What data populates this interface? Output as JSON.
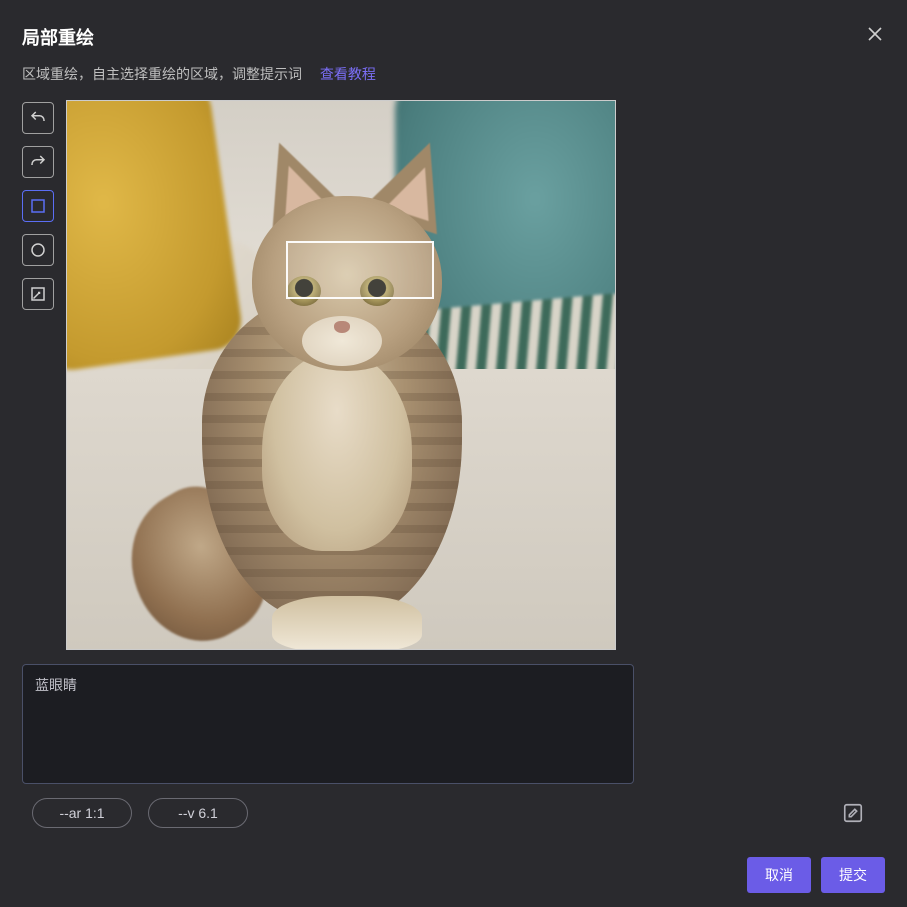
{
  "modal": {
    "title": "局部重绘",
    "subtitle": "区域重绘，自主选择重绘的区域，调整提示词",
    "tutorial_link": "查看教程"
  },
  "tools": {
    "undo": "undo",
    "redo": "redo",
    "rect": "rectangle-select",
    "circle": "circle-select",
    "lasso": "lasso-select"
  },
  "prompt": {
    "value": "蓝眼睛"
  },
  "params": {
    "aspect_ratio": "--ar 1:1",
    "version": "--v 6.1"
  },
  "footer": {
    "cancel": "取消",
    "submit": "提交"
  }
}
